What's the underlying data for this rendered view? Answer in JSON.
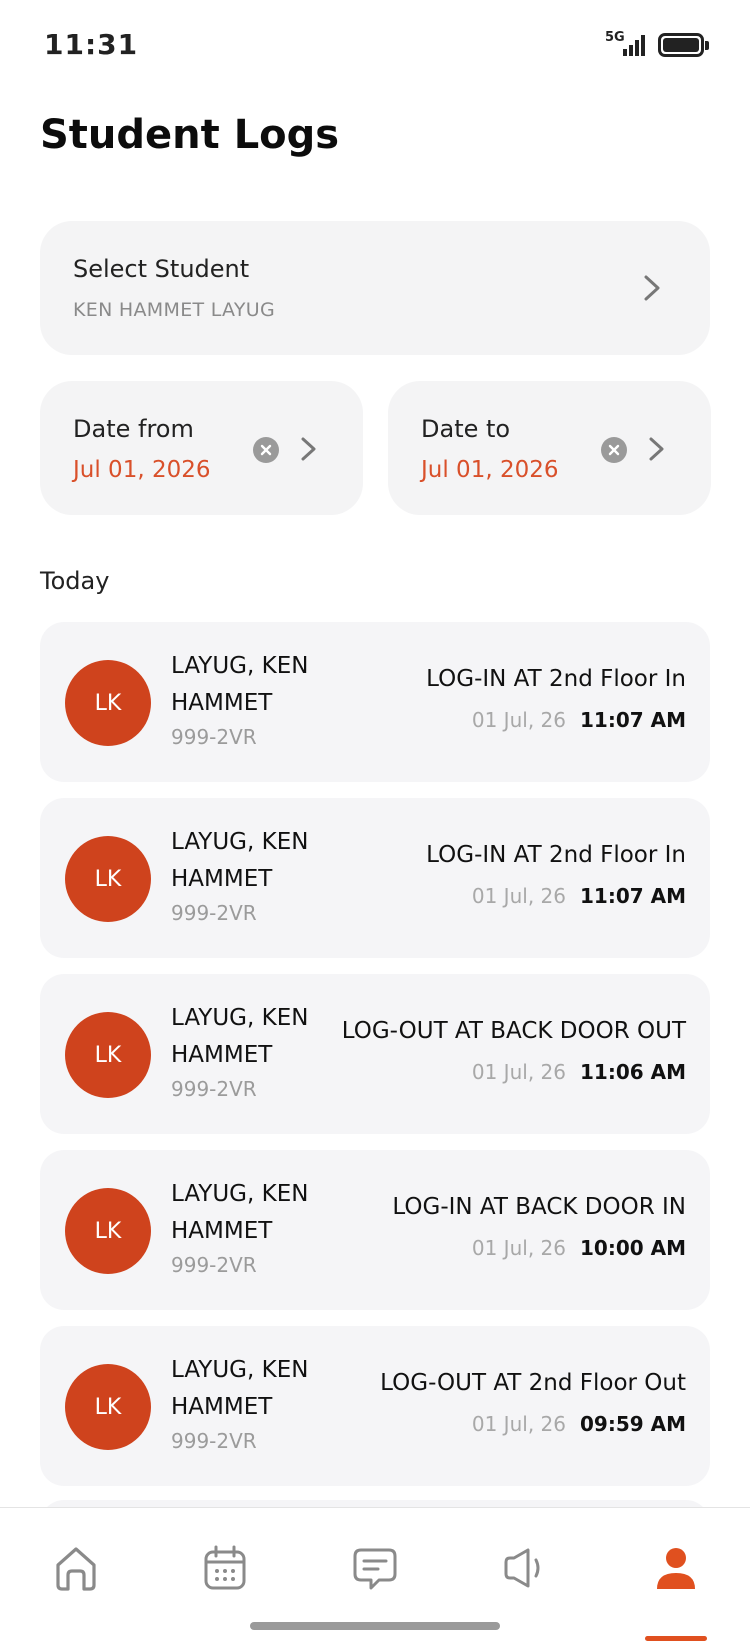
{
  "status": {
    "time": "11:31",
    "network": "5G"
  },
  "header": {
    "title": "Student Logs"
  },
  "filters": {
    "student": {
      "label": "Select Student",
      "value": "KEN HAMMET LAYUG"
    },
    "date_from": {
      "label": "Date from",
      "value": "Jul 01, 2026"
    },
    "date_to": {
      "label": "Date to",
      "value": "Jul 01, 2026"
    }
  },
  "section": {
    "label": "Today"
  },
  "logs": [
    {
      "initials": "LK",
      "name": "LAYUG, KEN HAMMET",
      "id": "999-2VR",
      "event": "LOG-IN AT 2nd Floor In",
      "date": "01 Jul, 26",
      "time": "11:07 AM"
    },
    {
      "initials": "LK",
      "name": "LAYUG, KEN HAMMET",
      "id": "999-2VR",
      "event": "LOG-IN AT 2nd Floor In",
      "date": "01 Jul, 26",
      "time": "11:07 AM"
    },
    {
      "initials": "LK",
      "name": "LAYUG, KEN HAMMET",
      "id": "999-2VR",
      "event": "LOG-OUT AT BACK DOOR OUT",
      "date": "01 Jul, 26",
      "time": "11:06 AM"
    },
    {
      "initials": "LK",
      "name": "LAYUG, KEN HAMMET",
      "id": "999-2VR",
      "event": "LOG-IN AT BACK DOOR IN",
      "date": "01 Jul, 26",
      "time": "10:00 AM"
    },
    {
      "initials": "LK",
      "name": "LAYUG, KEN HAMMET",
      "id": "999-2VR",
      "event": "LOG-OUT AT 2nd Floor Out",
      "date": "01 Jul, 26",
      "time": "09:59 AM"
    }
  ],
  "nav": {
    "items": [
      {
        "icon": "home-icon"
      },
      {
        "icon": "calendar-icon"
      },
      {
        "icon": "chat-icon"
      },
      {
        "icon": "megaphone-icon"
      },
      {
        "icon": "profile-icon",
        "active": true
      }
    ],
    "accent": "#e0501f"
  },
  "colors": {
    "accent": "#cf431d",
    "date_value": "#d9502a",
    "card_bg": "#f4f4f5"
  }
}
